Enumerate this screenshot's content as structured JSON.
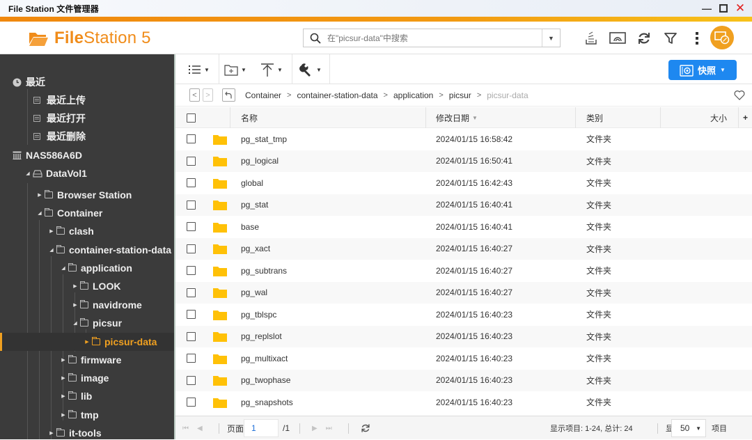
{
  "window": {
    "title": "File Station 文件管理器",
    "controls": {
      "minimize": "—",
      "maximize": "◻",
      "close": "✕"
    }
  },
  "header": {
    "logo_bold": "File",
    "logo_rest": "Station 5",
    "search_placeholder": "在\"picsur-data\"中搜索",
    "icons": [
      "upload-tray-icon",
      "remote-mount-icon",
      "refresh-icon",
      "filter-icon",
      "more-vertical-icon"
    ],
    "avatar_icon": "remote-desktop-icon"
  },
  "colors": {
    "accent_orange": "#f08c1a",
    "sidebar_bg": "#3b3b3b",
    "selected_text": "#f0a020",
    "primary_blue": "#1e88f0",
    "folder_yellow": "#ffc107"
  },
  "sidebar": {
    "recent": {
      "label": "最近",
      "items": [
        "最近上传",
        "最近打开",
        "最近删除"
      ]
    },
    "nas": {
      "label": "NAS586A6D"
    },
    "tree": [
      {
        "label": "DataVol1",
        "level": 1,
        "expanded": true,
        "kind": "volume"
      },
      {
        "label": "Browser Station",
        "level": 2,
        "expanded": false
      },
      {
        "label": "Container",
        "level": 2,
        "expanded": true
      },
      {
        "label": "clash",
        "level": 3,
        "expanded": false
      },
      {
        "label": "container-station-data",
        "level": 3,
        "expanded": true
      },
      {
        "label": "application",
        "level": 4,
        "expanded": true
      },
      {
        "label": "LOOK",
        "level": 5,
        "expanded": false
      },
      {
        "label": "navidrome",
        "level": 5,
        "expanded": false
      },
      {
        "label": "picsur",
        "level": 5,
        "expanded": true
      },
      {
        "label": "picsur-data",
        "level": 6,
        "expanded": false,
        "selected": true
      },
      {
        "label": "firmware",
        "level": 4,
        "expanded": false
      },
      {
        "label": "image",
        "level": 4,
        "expanded": false
      },
      {
        "label": "lib",
        "level": 4,
        "expanded": false
      },
      {
        "label": "tmp",
        "level": 4,
        "expanded": false
      },
      {
        "label": "it-tools",
        "level": 3,
        "expanded": false
      }
    ]
  },
  "toolbar": {
    "buttons": [
      "list-view-icon",
      "new-folder-icon",
      "upload-icon",
      "tools-icon"
    ],
    "snapshot_label": "快照"
  },
  "breadcrumb": {
    "items": [
      "Container",
      "container-station-data",
      "application",
      "picsur",
      "picsur-data"
    ]
  },
  "table": {
    "columns": {
      "name": "名称",
      "modified": "修改日期",
      "type": "类别",
      "size": "大小",
      "add": "+"
    },
    "rows": [
      {
        "name": "pg_stat_tmp",
        "modified": "2024/01/15 16:58:42",
        "type": "文件夹",
        "size": ""
      },
      {
        "name": "pg_logical",
        "modified": "2024/01/15 16:50:41",
        "type": "文件夹",
        "size": ""
      },
      {
        "name": "global",
        "modified": "2024/01/15 16:42:43",
        "type": "文件夹",
        "size": ""
      },
      {
        "name": "pg_stat",
        "modified": "2024/01/15 16:40:41",
        "type": "文件夹",
        "size": ""
      },
      {
        "name": "base",
        "modified": "2024/01/15 16:40:41",
        "type": "文件夹",
        "size": ""
      },
      {
        "name": "pg_xact",
        "modified": "2024/01/15 16:40:27",
        "type": "文件夹",
        "size": ""
      },
      {
        "name": "pg_subtrans",
        "modified": "2024/01/15 16:40:27",
        "type": "文件夹",
        "size": ""
      },
      {
        "name": "pg_wal",
        "modified": "2024/01/15 16:40:27",
        "type": "文件夹",
        "size": ""
      },
      {
        "name": "pg_tblspc",
        "modified": "2024/01/15 16:40:23",
        "type": "文件夹",
        "size": ""
      },
      {
        "name": "pg_replslot",
        "modified": "2024/01/15 16:40:23",
        "type": "文件夹",
        "size": ""
      },
      {
        "name": "pg_multixact",
        "modified": "2024/01/15 16:40:23",
        "type": "文件夹",
        "size": ""
      },
      {
        "name": "pg_twophase",
        "modified": "2024/01/15 16:40:23",
        "type": "文件夹",
        "size": ""
      },
      {
        "name": "pg_snapshots",
        "modified": "2024/01/15 16:40:23",
        "type": "文件夹",
        "size": ""
      }
    ]
  },
  "footer": {
    "page_label": "页面",
    "page_value": "1",
    "page_total": "/1",
    "display_info": "显示项目: 1-24, 总计: 24",
    "show_label": "显示",
    "per_page": "50",
    "items_label": "项目"
  }
}
